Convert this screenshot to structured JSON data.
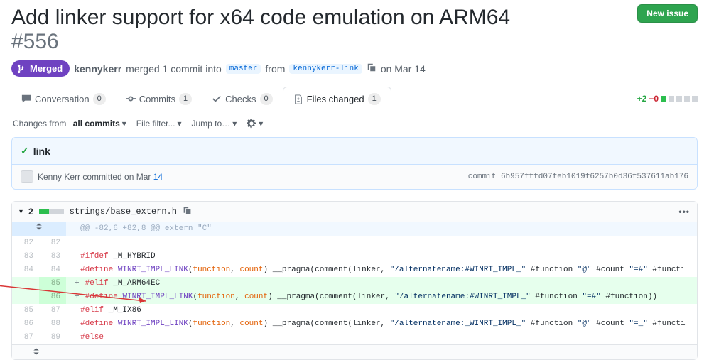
{
  "header": {
    "title": "Add linker support for x64 code emulation on ARM64",
    "number": "#556",
    "new_issue": "New issue"
  },
  "state": {
    "label": "Merged"
  },
  "meta": {
    "author": "kennykerr",
    "action_text": "merged 1 commit into",
    "base_branch": "master",
    "from": "from",
    "head_branch": "kennykerr-link",
    "date": "on Mar 14"
  },
  "tabs": {
    "conversation": {
      "label": "Conversation",
      "count": "0"
    },
    "commits": {
      "label": "Commits",
      "count": "1"
    },
    "checks": {
      "label": "Checks",
      "count": "0"
    },
    "files": {
      "label": "Files changed",
      "count": "1"
    }
  },
  "diffstat": {
    "add": "+2",
    "del": "−0"
  },
  "toolbar": {
    "changes_from": "Changes from",
    "all_commits": "all commits",
    "file_filter": "File filter...",
    "jump_to": "Jump to…"
  },
  "commit": {
    "title": "link",
    "committer": "Kenny Kerr",
    "committed": "committed on Mar",
    "day": "14",
    "sha_label": "commit",
    "sha": "6b957fffd07feb1019f6257b0d36f537611ab176"
  },
  "file": {
    "change_count": "2",
    "path": "strings/base_extern.h",
    "hunk": "@@ -82,6 +82,8 @@ extern \"C\""
  },
  "diff": [
    {
      "t": "ctx",
      "a": "82",
      "b": "82",
      "html": ""
    },
    {
      "t": "ctx",
      "a": "83",
      "b": "83",
      "html": "<span class='kw'>#ifdef</span> _M_HYBRID"
    },
    {
      "t": "ctx",
      "a": "84",
      "b": "84",
      "html": "<span class='kw'>#define</span> <span class='mac'>WINRT_IMPL_LINK</span>(<span class='arg'>function</span>, <span class='arg'>count</span>) __pragma(comment(linker, <span class='str'>\"/alternatename:#WINRT_IMPL_\"</span> #function <span class='str'>\"@\"</span> #count <span class='str'>\"=#\"</span> #functi"
    },
    {
      "t": "add",
      "a": "",
      "b": "85",
      "html": "<span class='sign'>+</span> <span class='kw'>#elif</span> _M_ARM64EC"
    },
    {
      "t": "add",
      "a": "",
      "b": "86",
      "html": "<span class='sign'>+</span> <span class='kw'>#define</span> <span class='mac'>WINRT_IMPL_LINK</span>(<span class='arg'>function</span>, <span class='arg'>count</span>) __pragma(comment(linker, <span class='str'>\"/alternatename:#WINRT_IMPL_\"</span> #function <span class='str'>\"=#\"</span> #function))"
    },
    {
      "t": "ctx",
      "a": "85",
      "b": "87",
      "html": "<span class='kw'>#elif</span> _M_IX86"
    },
    {
      "t": "ctx",
      "a": "86",
      "b": "88",
      "html": "<span class='kw'>#define</span> <span class='mac'>WINRT_IMPL_LINK</span>(<span class='arg'>function</span>, <span class='arg'>count</span>) __pragma(comment(linker, <span class='str'>\"/alternatename:_WINRT_IMPL_\"</span> #function <span class='str'>\"@\"</span> #count <span class='str'>\"=_\"</span> #functi"
    },
    {
      "t": "ctx",
      "a": "87",
      "b": "89",
      "html": "<span class='kw'>#else</span>"
    }
  ]
}
